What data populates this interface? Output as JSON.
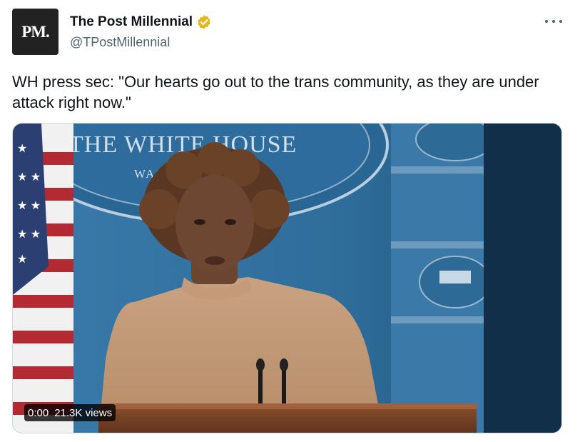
{
  "author": {
    "avatar_text": "PM.",
    "display_name": "The Post Millennial",
    "handle": "@TPostMillennial",
    "verified_badge": "gold-verified-icon"
  },
  "tweet": {
    "text": "WH press sec: \"Our hearts go out to the trans community, as they are under attack right now.\""
  },
  "media": {
    "type": "video",
    "scene_text": {
      "seal_title": "THE WHITE HOUSE",
      "seal_subtitle": "WASHINGTON"
    },
    "time": "0:00",
    "views": "21.3K views",
    "progress": 0
  },
  "colors": {
    "verified_gold": "#e2b719",
    "backdrop_blue": "#2f6d9b",
    "sweater": "#c49a78"
  }
}
